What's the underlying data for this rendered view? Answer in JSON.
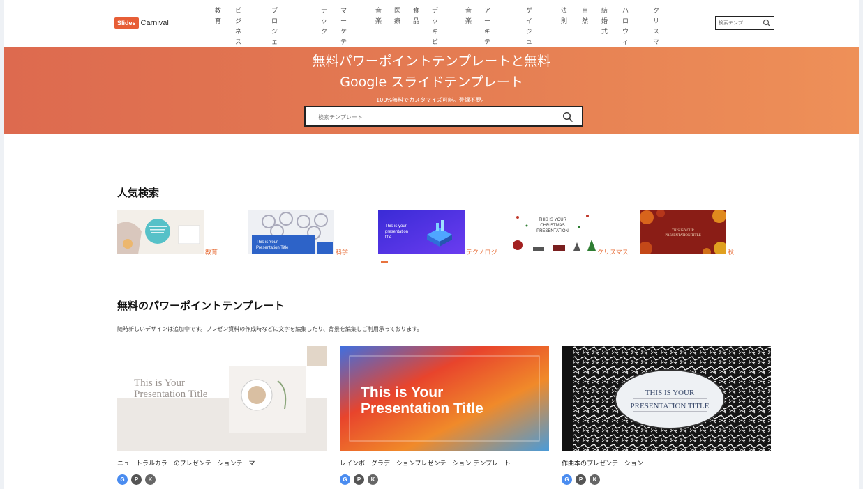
{
  "header": {
    "logo_badge": "Slides",
    "logo_text": "Carnival",
    "nav": [
      "教\n育",
      "ビジネ\nスプラ\nン",
      "プロジェク\nト提案書で\nす",
      "テ\nッ\nク",
      "マーケ\nティン\nグ",
      "音\n楽",
      "医\n療",
      "食\n品",
      "デッ\nキビ\nッチ",
      "音\n楽",
      "アーキ\nテクチ\nャー",
      "ゲイ\nジュ\nツ",
      "法\n則",
      "自\n然",
      "結\n婚\n式",
      "ハロ\nウィ\nーン",
      "クリ\nスマ\nス"
    ],
    "search_placeholder": "検索テンプ"
  },
  "hero": {
    "title_line1": "無料パワーポイントテンプレートと無料",
    "title_line2": "Google スライドテンプレート",
    "subtitle": "100%無料でカスタマイズ可能。登録不要。",
    "search_placeholder": "検索テンプレート"
  },
  "popular": {
    "heading": "人気検索",
    "items": [
      {
        "label": "教育"
      },
      {
        "label": "科学",
        "thumb_text_1": "This is Your",
        "thumb_text_2": "Presentation Title"
      },
      {
        "label": "テクノロジ",
        "thumb_text_1": "This is your",
        "thumb_text_2": "presentation",
        "thumb_text_3": "title"
      },
      {
        "label": "クリスマス",
        "thumb_text_1": "THIS IS YOUR",
        "thumb_text_2": "CHRISTMAS",
        "thumb_text_3": "PRESENTATION"
      },
      {
        "label": "秋",
        "thumb_text_1": "THIS IS YOUR",
        "thumb_text_2": "PRESENTATION TITLE"
      }
    ]
  },
  "templates": {
    "heading": "無料のパワーポイントテンプレート",
    "description": "随時新しいデザインは追加中です。プレゼン資料の作成時などに文字を編集したり、背景を編集しご利用承っております。",
    "cards": [
      {
        "title": "ニュートラルカラーのプレゼンテーションテーマ",
        "thumb_line1": "This is Your",
        "thumb_line2": "Presentation Title"
      },
      {
        "title": "レインボーグラデーションプレゼンテーション テンプレート",
        "thumb_line1": "This is Your",
        "thumb_line2": "Presentation Title"
      },
      {
        "title": "作曲本のプレゼンテーション",
        "thumb_line1": "THIS IS YOUR",
        "thumb_line2": "PRESENTATION TITLE"
      }
    ],
    "icon_letters": {
      "google": "G",
      "powerpoint": "P",
      "keynote": "K"
    }
  },
  "colors": {
    "accent": "#e8733f",
    "hero_start": "#dd6a4f",
    "hero_end": "#ee9058",
    "google_blue": "#4a8cf0"
  }
}
